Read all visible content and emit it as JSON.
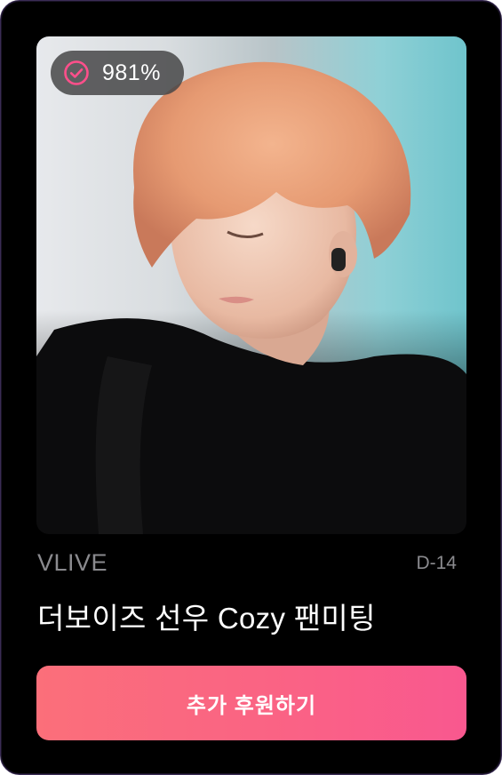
{
  "badge": {
    "icon": "check-circle-icon",
    "value": "981%",
    "icon_color": "#ff4f8b"
  },
  "campaign": {
    "platform": "VLIVE",
    "dday": "D-14",
    "title": "더보이즈 선우 Cozy 팬미팅"
  },
  "cta": {
    "label": "추가 후원하기",
    "gradient_start": "#fb6f7a",
    "gradient_end": "#f9588f"
  }
}
